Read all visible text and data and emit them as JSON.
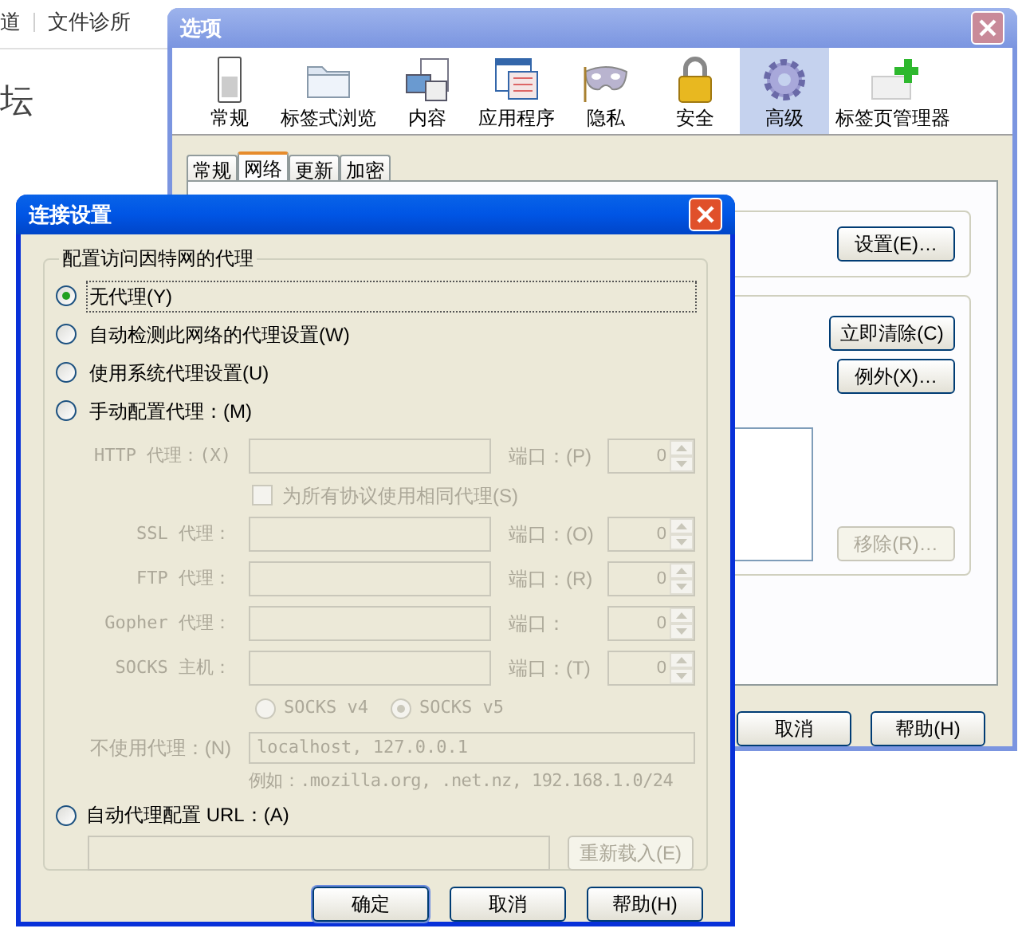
{
  "background_page": {
    "nav_links": [
      "道",
      "文件诊所"
    ],
    "heading": "坛"
  },
  "options_window": {
    "title": "选项",
    "toolbar": [
      {
        "label": "常规",
        "kind": "switch",
        "selected": false
      },
      {
        "label": "标签式浏览",
        "kind": "folder",
        "selected": false
      },
      {
        "label": "内容",
        "kind": "content",
        "selected": false
      },
      {
        "label": "应用程序",
        "kind": "apps",
        "selected": false
      },
      {
        "label": "隐私",
        "kind": "mask",
        "selected": false
      },
      {
        "label": "安全",
        "kind": "lock",
        "selected": false
      },
      {
        "label": "高级",
        "kind": "gear",
        "selected": true
      },
      {
        "label": "标签页管理器",
        "kind": "tabadd",
        "selected": false
      }
    ],
    "subtabs": [
      {
        "label": "常规",
        "selected": false
      },
      {
        "label": "网络",
        "selected": true
      },
      {
        "label": "更新",
        "selected": false
      },
      {
        "label": "加密",
        "selected": false
      }
    ],
    "settings_button": {
      "label": "设置(E)…",
      "disabled": false
    },
    "cache_buttons": [
      {
        "label": "立即清除(C)",
        "disabled": false
      },
      {
        "label": "例外(X)…",
        "disabled": false
      }
    ],
    "remove_button": {
      "label": "移除(R)…",
      "disabled": true
    },
    "footer_buttons": [
      "取消",
      "帮助(H)"
    ]
  },
  "connection_dialog": {
    "title": "连接设置",
    "group_label": "配置访问因特网的代理",
    "modes": [
      {
        "label": "无代理(Y)",
        "selected": true
      },
      {
        "label": "自动检测此网络的代理设置(W)",
        "selected": false
      },
      {
        "label": "使用系统代理设置(U)",
        "selected": false
      },
      {
        "label": "手动配置代理：(M)",
        "selected": false
      }
    ],
    "proxies": [
      {
        "label": "HTTP 代理：(X)",
        "port_label": "端口：(P)",
        "port": "0",
        "disabled": true
      },
      {
        "label": "SSL 代理：",
        "port_label": "端口：(O)",
        "port": "0",
        "disabled": true
      },
      {
        "label": "FTP 代理：",
        "port_label": "端口：(R)",
        "port": "0",
        "disabled": true
      },
      {
        "label": "Gopher 代理：",
        "port_label": "端口：",
        "port": "0",
        "disabled": true
      },
      {
        "label": "SOCKS 主机：",
        "port_label": "端口：(T)",
        "port": "0",
        "disabled": true
      }
    ],
    "same_proxy": {
      "label": "为所有协议使用相同代理(S)",
      "checked": false,
      "disabled": true
    },
    "socks_versions": [
      {
        "label": "SOCKS v4",
        "selected": false
      },
      {
        "label": "SOCKS v5",
        "selected": true
      }
    ],
    "no_proxy": {
      "label": "不使用代理：(N)",
      "value": "localhost, 127.0.0.1",
      "example": "例如：.mozilla.org, .net.nz, 192.168.1.0/24",
      "disabled": true
    },
    "auto_config": {
      "label": "自动代理配置 URL：(A)",
      "selected": false,
      "reload_button": {
        "label": "重新载入(E)",
        "disabled": true
      }
    },
    "buttons": [
      {
        "label": "确定",
        "default": true
      },
      {
        "label": "取消",
        "default": false
      },
      {
        "label": "帮助(H)",
        "default": false
      }
    ]
  }
}
